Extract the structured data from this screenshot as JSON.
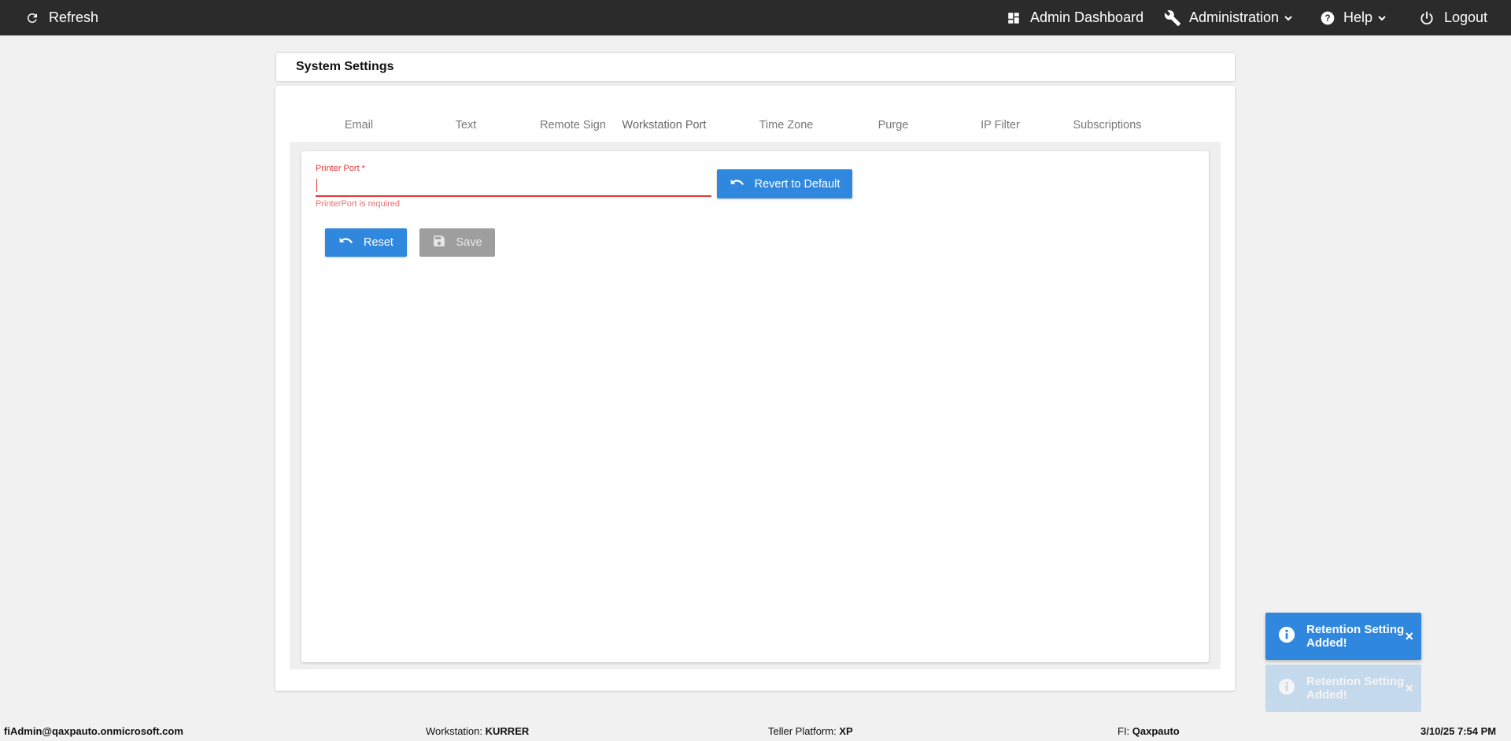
{
  "topbar": {
    "refresh_label": "Refresh",
    "admin_dashboard_label": "Admin Dashboard",
    "administration_label": "Administration",
    "help_label": "Help",
    "logout_label": "Logout"
  },
  "page": {
    "title": "System Settings"
  },
  "tabs": [
    {
      "label": "Email"
    },
    {
      "label": "Text"
    },
    {
      "label": "Remote Sign"
    },
    {
      "label": "Workstation Port"
    },
    {
      "label": "Time Zone"
    },
    {
      "label": "Purge"
    },
    {
      "label": "IP Filter"
    },
    {
      "label": "Subscriptions"
    }
  ],
  "active_tab": "Workstation Port",
  "form": {
    "printer_port_label": "Printer Port *",
    "printer_port_value": "",
    "printer_port_error": "PrinterPort is required",
    "revert_label": "Revert to Default",
    "reset_label": "Reset",
    "save_label": "Save"
  },
  "toasts": [
    {
      "message": "Retention Setting Added!",
      "close": "×"
    },
    {
      "message": "Retention Setting Added!",
      "close": "×"
    }
  ],
  "footer": {
    "user": "fiAdmin@qaxpauto.onmicrosoft.com",
    "workstation_label": "Workstation:",
    "workstation_value": "KURRER",
    "teller_platform_label": "Teller Platform:",
    "teller_platform_value": "XP",
    "fi_label": "FI:",
    "fi_value": "Qaxpauto",
    "datetime": "3/10/25 7:54 PM"
  },
  "colors": {
    "topbar_bg": "#2b2b2b",
    "primary_button": "#2f88de",
    "error": "#e53935",
    "tab_indicator": "#3f51b5",
    "disabled_button": "#9e9e9e"
  },
  "icons": {
    "refresh": "refresh-icon",
    "dashboard": "dashboard-icon",
    "administration": "wrench-icon",
    "help": "help-circle-icon",
    "logout": "power-icon",
    "undo": "undo-icon",
    "save": "floppy-icon",
    "info": "info-icon"
  }
}
